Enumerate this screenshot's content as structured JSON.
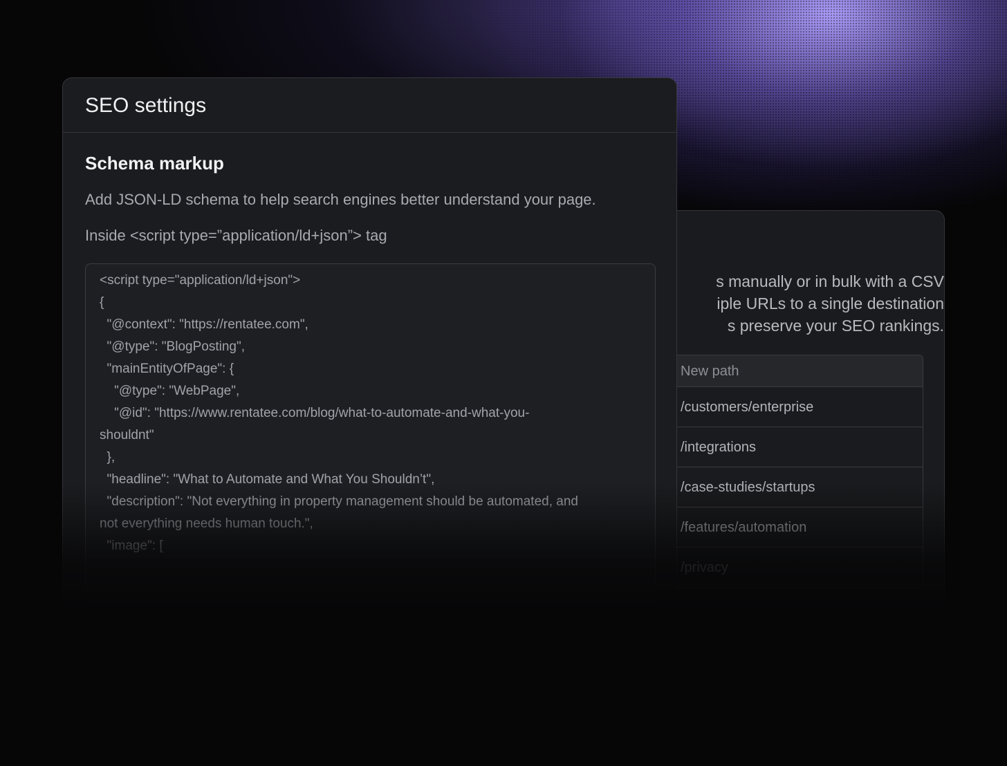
{
  "seo_settings": {
    "title": "SEO settings",
    "section_title": "Schema markup",
    "section_description": "Add JSON-LD schema to help search engines better understand your page.",
    "field_label": "Inside <script type=”application/ld+json”> tag",
    "code_lines": [
      "<script type=\"application/ld+json\">",
      "{",
      "  \"@context\": \"https://rentatee.com\",",
      "  \"@type\": \"BlogPosting\",",
      "  \"mainEntityOfPage\": {",
      "    \"@type\": \"WebPage\",",
      "    \"@id\": \"https://www.rentatee.com/blog/what-to-automate-and-what-you-",
      "shouldnt\"",
      "  },",
      "  \"headline\": \"What to Automate and What You Shouldn’t\",",
      "  \"description\": \"Not everything in property management should be automated, and",
      "not everything needs human touch.\",",
      "  \"image\": ["
    ]
  },
  "redirects": {
    "description_lines": [
      "s manually or in bulk with a CSV",
      "iple URLs to a single destination",
      "s preserve your SEO rankings."
    ],
    "table": {
      "header": "New path",
      "rows": [
        "/customers/enterprise",
        "/integrations",
        "/case-studies/startups",
        "/features/automation",
        "/privacy"
      ]
    }
  }
}
